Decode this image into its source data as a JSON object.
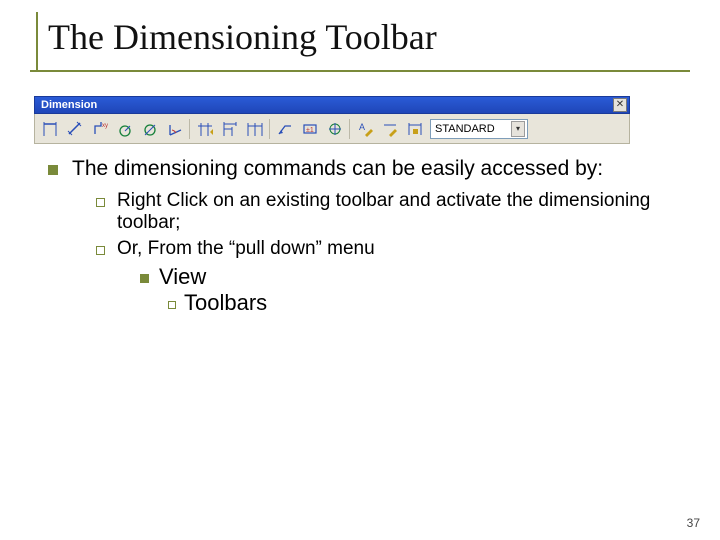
{
  "title": "The Dimensioning Toolbar",
  "toolbar": {
    "title": "Dimension",
    "close": "✕",
    "style_value": "STANDARD",
    "icons": [
      "linear-dim-icon",
      "aligned-dim-icon",
      "ordinate-dim-icon",
      "radius-dim-icon",
      "diameter-dim-icon",
      "angular-dim-icon",
      "quick-dim-icon",
      "baseline-dim-icon",
      "continue-dim-icon",
      "leader-dim-icon",
      "tolerance-icon",
      "center-mark-icon",
      "dim-edit-icon",
      "dim-text-edit-icon",
      "dim-update-icon"
    ]
  },
  "content": {
    "main_bullet": "The dimensioning commands can be easily accessed by:",
    "sub": [
      "Right Click on an existing toolbar and activate the dimensioning toolbar;",
      "Or, From the “pull down” menu"
    ],
    "lvl3": "View",
    "lvl4": "Toolbars"
  },
  "page_number": "37"
}
